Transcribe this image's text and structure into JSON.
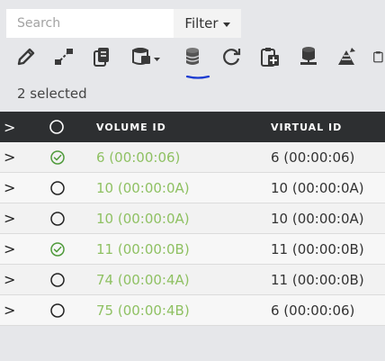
{
  "search": {
    "placeholder": "Search",
    "value": ""
  },
  "filter": {
    "label": "Filter"
  },
  "toolbar": {
    "icons": [
      "edit-icon",
      "connect-icon",
      "copy-icon",
      "database-menu-icon",
      "volume-icon",
      "refresh-icon",
      "add-to-clipboard-icon",
      "database-server-icon",
      "deploy-icon",
      "clipboard-icon"
    ],
    "active": "volume-icon",
    "icon_color": "#3a3a3a",
    "active_underline_color": "#1a3bd1"
  },
  "selection": {
    "text": "2 selected"
  },
  "table": {
    "header": {
      "expand": ">",
      "col_volume": "VOLUME ID",
      "col_virtual": "VIRTUAL ID"
    },
    "rows": [
      {
        "expand": ">",
        "checked": true,
        "volume_id": "6 (00:00:06)",
        "virtual_id": "6 (00:00:06)"
      },
      {
        "expand": ">",
        "checked": false,
        "volume_id": "10 (00:00:0A)",
        "virtual_id": "10 (00:00:0A)"
      },
      {
        "expand": ">",
        "checked": false,
        "volume_id": "10 (00:00:0A)",
        "virtual_id": "10 (00:00:0A)"
      },
      {
        "expand": ">",
        "checked": true,
        "volume_id": "11 (00:00:0B)",
        "virtual_id": "11 (00:00:0B)"
      },
      {
        "expand": ">",
        "checked": false,
        "volume_id": "74 (00:00:4A)",
        "virtual_id": "11 (00:00:0B)"
      },
      {
        "expand": ">",
        "checked": false,
        "volume_id": "75 (00:00:4B)",
        "virtual_id": "6 (00:00:06)"
      }
    ],
    "colors": {
      "header_bg": "#2d2f31",
      "volume_text": "#8fc163",
      "check": "#4e9a3a"
    }
  }
}
